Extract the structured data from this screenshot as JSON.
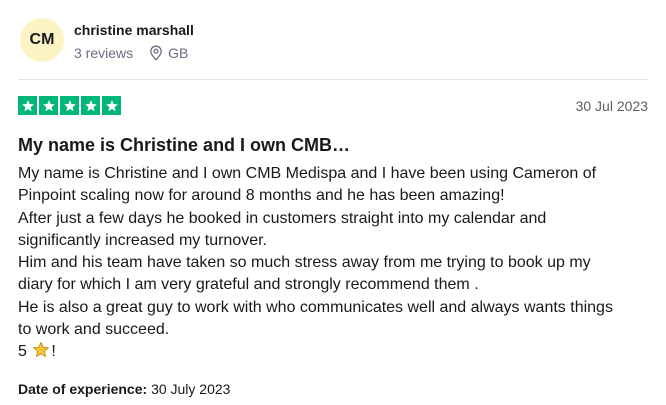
{
  "reviewer": {
    "initials": "CM",
    "name": "christine marshall",
    "reviews_count": "3 reviews",
    "country": "GB"
  },
  "review": {
    "rating": 5,
    "date": "30 Jul 2023",
    "title": "My name is Christine and I own CMB…",
    "body_lines": [
      "My name is Christine and I own CMB Medispa and I have been using Cameron of",
      "Pinpoint scaling now for around 8 months and he has been amazing!",
      "After just a few days he booked in customers straight into my calendar and",
      "significantly increased my turnover.",
      "Him and his team have taken so much stress away from me trying to book up my",
      "diary for which I am very grateful and strongly recommend them .",
      "He is also a great guy to work with who communicates well and always wants things",
      "to work and succeed."
    ],
    "closing_before": "5",
    "closing_after": "!",
    "experience_label": "Date of experience:",
    "experience_date": "30 July 2023"
  },
  "colors": {
    "star_green": "#00b67a",
    "avatar_bg": "#fcf3c5",
    "meta_gray": "#6c6c85"
  },
  "icons": {
    "location": "location-pin-icon",
    "star": "star-icon",
    "star_emoji": "star-emoji-icon"
  }
}
